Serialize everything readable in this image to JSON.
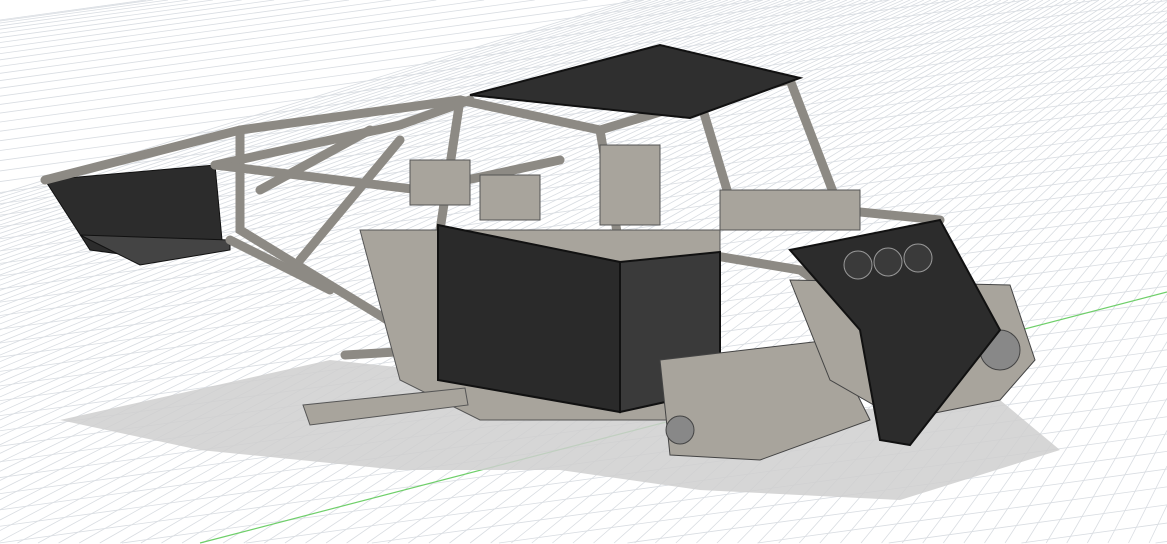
{
  "viewport": {
    "background_color": "#ffffff",
    "grid_color": "#d9dde2",
    "x_axis_color": "#6fcf6a",
    "shadow_color": "#c9c9c9"
  },
  "model": {
    "panel_color": "#2f2f2f",
    "tube_color": "#8d8a84",
    "metal_color": "#a8a49c",
    "edge_color": "#1b1b1b"
  }
}
